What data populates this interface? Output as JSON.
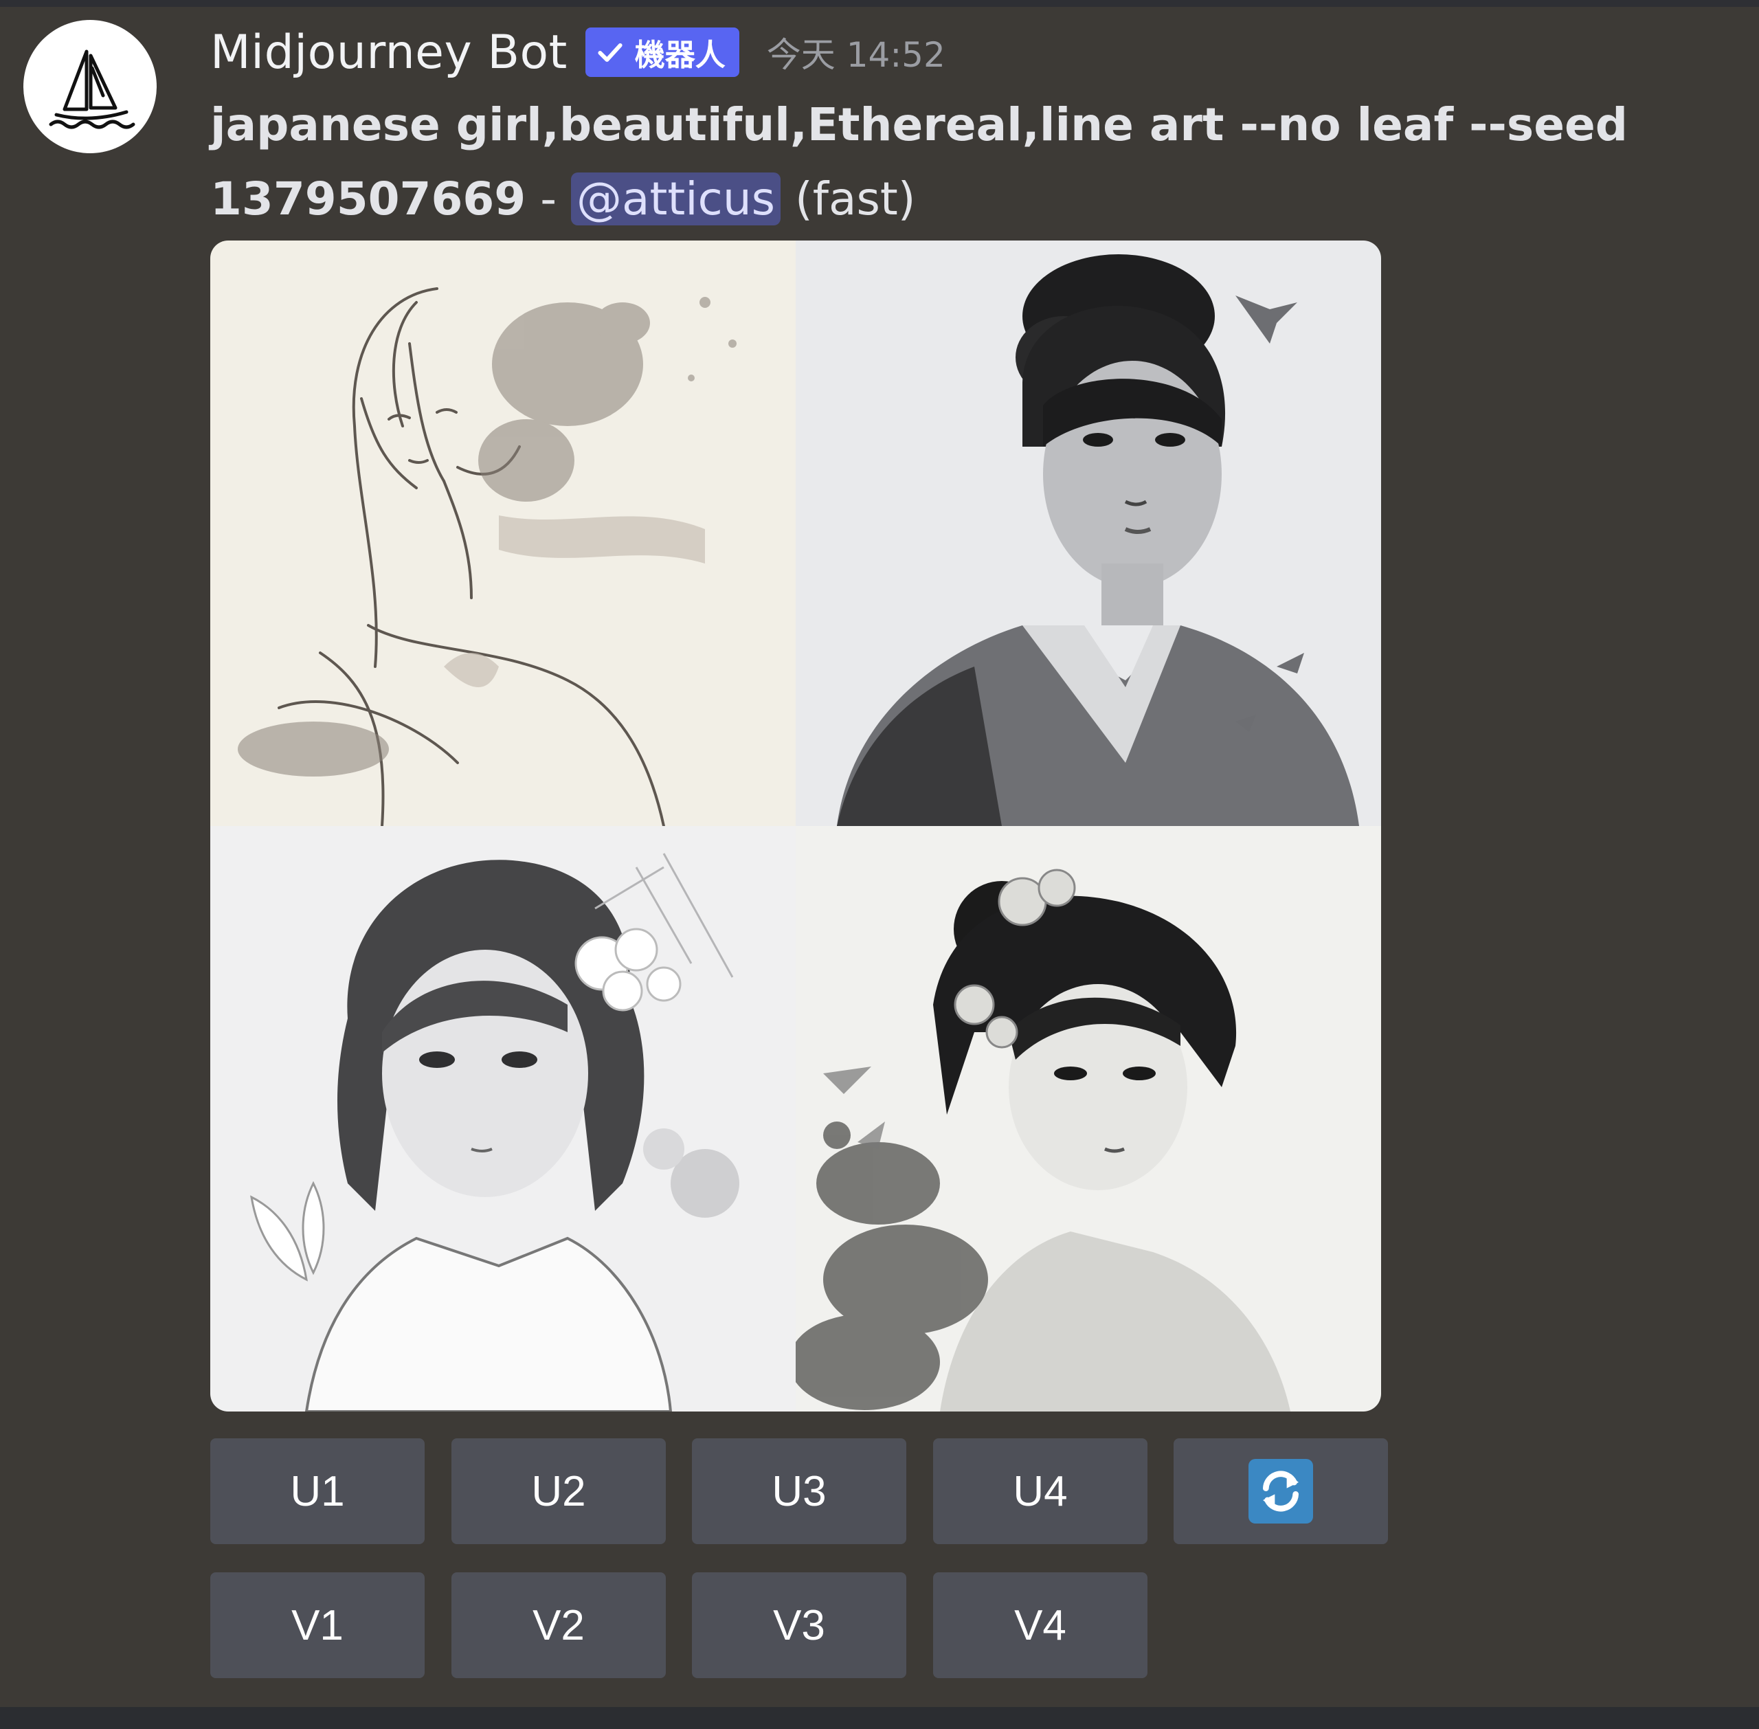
{
  "message": {
    "author": "Midjourney Bot",
    "bot_badge": "機器人",
    "timestamp": "今天 14:52",
    "prompt_line1": "japanese girl,beautiful,Ethereal,line art --no leaf --seed",
    "prompt_line2_bold": "1379507669",
    "separator": " - ",
    "mention": "@atticus",
    "speed": " (fast)"
  },
  "image_grid": {
    "tiles": [
      "image-1",
      "image-2",
      "image-3",
      "image-4"
    ]
  },
  "buttons": {
    "upscale": [
      "U1",
      "U2",
      "U3",
      "U4"
    ],
    "variation": [
      "V1",
      "V2",
      "V3",
      "V4"
    ],
    "reroll_icon": "refresh-icon"
  },
  "colors": {
    "background": "#3d3a36",
    "button": "#4e5058",
    "badge": "#5865f2",
    "mention_bg": "#4b4f86",
    "refresh": "#3b88c3"
  }
}
